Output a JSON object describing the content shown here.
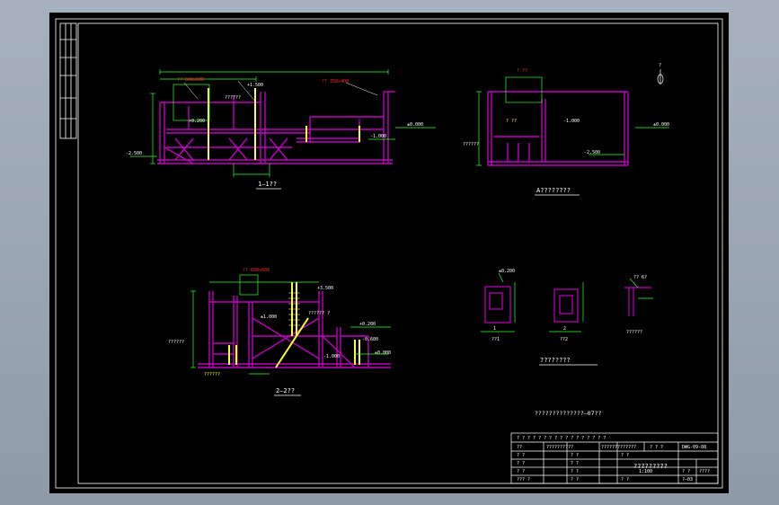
{
  "colors": {
    "frame": "#ffffff",
    "structure": "#c000c0",
    "column": "#ffff30",
    "dimension": "#30ff30",
    "annotation": "#ff3030",
    "text": "#ffffff",
    "background": "#000000"
  },
  "sections": {
    "s1": {
      "title": "1—1??",
      "dims": [
        "-2.500",
        "±0.000",
        "-1.000",
        "+1.500",
        "+0.200"
      ],
      "notes": [
        "?? 350x400",
        "?? 600x600",
        "??????"
      ]
    },
    "s2": {
      "title": "A????????",
      "dims": [
        "±0.000",
        "-2.500",
        "-1.000"
      ],
      "notes": [
        "? ??",
        "? ??",
        "??????"
      ]
    },
    "s3": {
      "title": "2—2??",
      "dims": [
        "+3.500",
        "±1.000",
        "+0.200",
        "-0.600",
        "-1.000",
        "±0.000"
      ],
      "notes": [
        "?? 600x600",
        "??????",
        "?????? ?",
        "??????"
      ]
    },
    "details": {
      "title": "????????",
      "items": [
        "1",
        "??1",
        "2",
        "??2",
        "??????"
      ],
      "dims": [
        "±0.200",
        "?? 6?"
      ]
    },
    "north": "?"
  },
  "note": "??????????????—07??",
  "title_block": {
    "header": "?  ?  ?  ?  ?  ?  ?  ?  ?  ?  ?  ?  ?  ?  ?  ?  ?",
    "row1": [
      "??",
      "??????????",
      "?????????????",
      "?  ?  ?",
      "DWG-09-08"
    ],
    "row2": [
      "?  ?",
      "?  ?",
      "?  ?"
    ],
    "row3": [
      "?  ?",
      "?  ?",
      "?????????"
    ],
    "row4": [
      "?  ?",
      "?  ?",
      "1:100",
      "?  ?",
      "????"
    ],
    "row5": [
      "??? ?",
      "?  ?",
      "?  ?",
      "?—03"
    ]
  }
}
